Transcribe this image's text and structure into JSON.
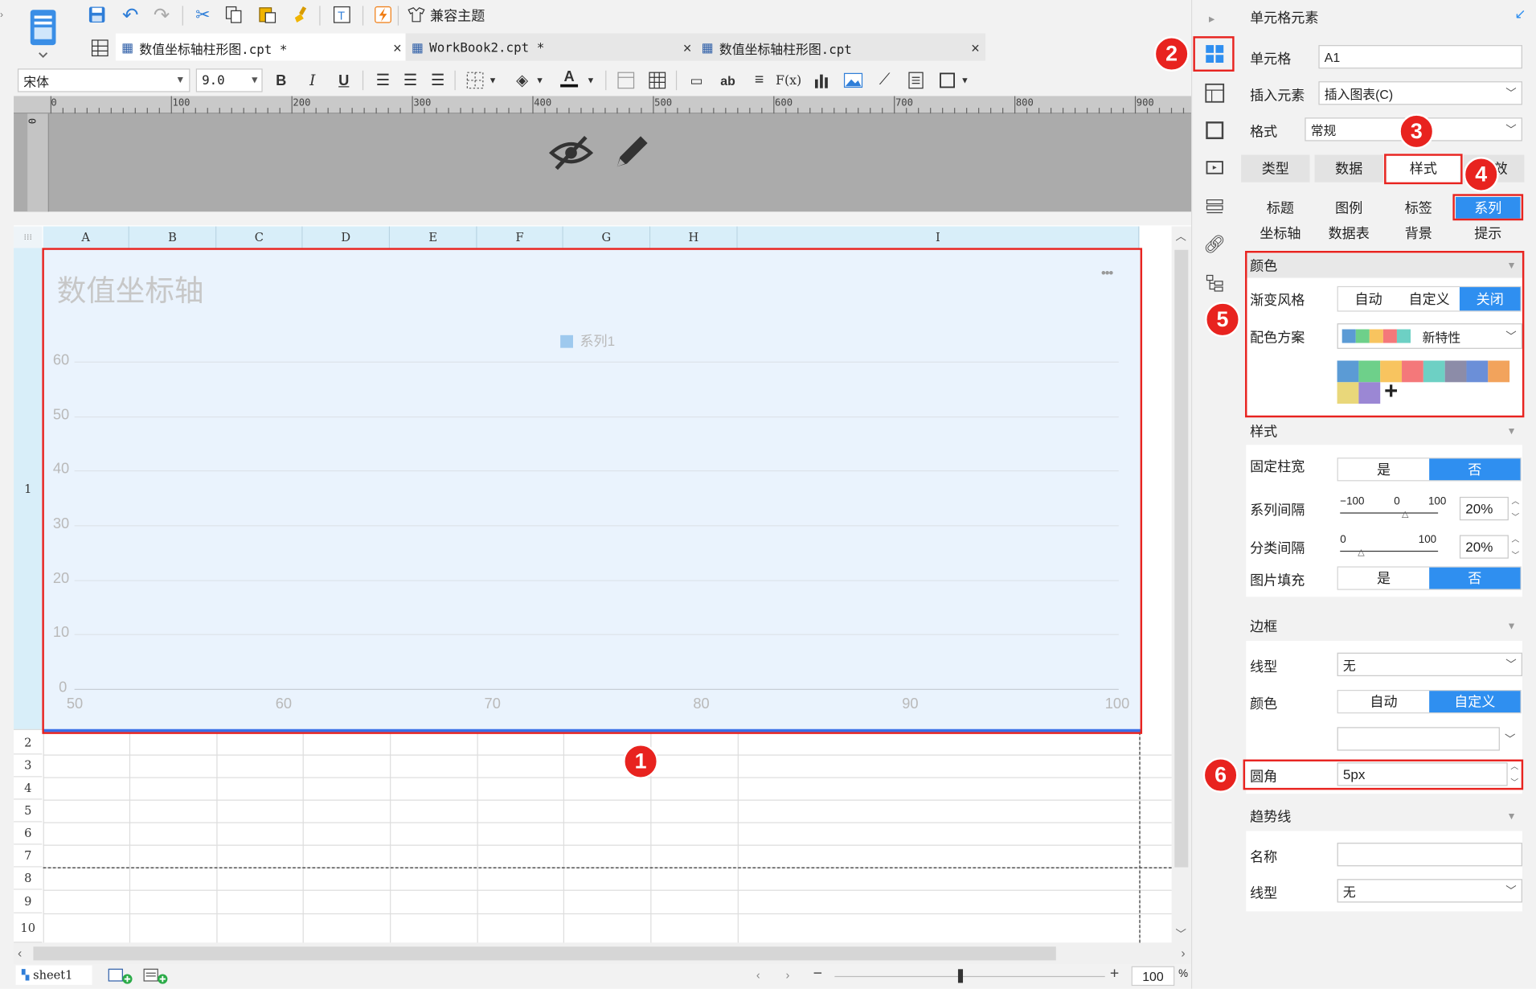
{
  "toolbar": {
    "theme_button": "兼容主题",
    "font_name": "宋体",
    "font_size": "9.0",
    "bold": "B",
    "italic": "I",
    "underline": "U",
    "text_color_glyph": "A",
    "ab_glyph": "ab",
    "fx_glyph": "F(x)"
  },
  "tabs": [
    {
      "label": "数值坐标轴柱形图.cpt *"
    },
    {
      "label": "WorkBook2.cpt *"
    },
    {
      "label": "数值坐标轴柱形图.cpt"
    }
  ],
  "ruler": {
    "ticks": [
      "0",
      "100",
      "200",
      "300",
      "400",
      "500",
      "600",
      "700",
      "800",
      "900"
    ],
    "vertical_zero": "0"
  },
  "sheet": {
    "columns": [
      "A",
      "B",
      "C",
      "D",
      "E",
      "F",
      "G",
      "H",
      "I"
    ],
    "rows": [
      "1",
      "2",
      "3",
      "4",
      "5",
      "6",
      "7",
      "8",
      "9",
      "10"
    ],
    "tab_name": "sheet1",
    "zoom_value": "100",
    "zoom_unit": "%"
  },
  "chart_data": {
    "type": "bar",
    "title": "数值坐标轴",
    "series": [
      {
        "name": "系列1",
        "values": []
      }
    ],
    "x_ticks": [
      "50",
      "60",
      "70",
      "80",
      "90",
      "100"
    ],
    "y_ticks": [
      "0",
      "10",
      "20",
      "30",
      "40",
      "50",
      "60"
    ],
    "xlim": [
      50,
      100
    ],
    "ylim": [
      0,
      60
    ],
    "grid": true,
    "legend_position": "top",
    "menu_glyph": "•••",
    "background": "#eaf3fd",
    "legend_color": "#9ec9ee"
  },
  "panel": {
    "header": "单元格元素",
    "cell_label": "单元格",
    "cell_value": "A1",
    "insert_label": "插入元素",
    "insert_value": "插入图表(C)",
    "format_label": "格式",
    "format_value": "常规",
    "main_tabs": [
      "类型",
      "数据",
      "样式",
      "特效"
    ],
    "sub_tabs_row1": [
      "标题",
      "图例",
      "标签",
      "系列"
    ],
    "sub_tabs_row2": [
      "坐标轴",
      "数据表",
      "背景",
      "提示"
    ],
    "color_section": "颜色",
    "gradient_label": "渐变风格",
    "gradient_options": [
      "自动",
      "自定义",
      "关闭"
    ],
    "gradient_selected": "关闭",
    "scheme_label": "配色方案",
    "scheme_value": "新特性",
    "scheme_colors": [
      "#5b9bd5",
      "#6ed08a",
      "#f8c45f",
      "#f4787a",
      "#6dd0c4",
      "#8c8ca8",
      "#6b8fd8",
      "#f2a35c",
      "#e9d77a",
      "#9b87d4"
    ],
    "add_glyph": "+",
    "style_section": "样式",
    "fixed_width_label": "固定柱宽",
    "yes": "是",
    "no": "否",
    "series_gap_label": "系列间隔",
    "series_gap_min": "−100",
    "series_gap_mid": "0",
    "series_gap_max": "100",
    "series_gap_value": "20%",
    "category_gap_label": "分类间隔",
    "category_gap_min": "0",
    "category_gap_max": "100",
    "category_gap_value": "20%",
    "image_fill_label": "图片填充",
    "border_section": "边框",
    "line_type_label": "线型",
    "line_type_value": "无",
    "border_color_label": "颜色",
    "color_options": [
      "自动",
      "自定义"
    ],
    "color_selected": "自定义",
    "radius_label": "圆角",
    "radius_value": "5px",
    "trend_section": "趋势线",
    "name_label": "名称",
    "trend_line_label": "线型",
    "trend_line_value": "无"
  },
  "badges": [
    "1",
    "2",
    "3",
    "4",
    "5",
    "6"
  ]
}
